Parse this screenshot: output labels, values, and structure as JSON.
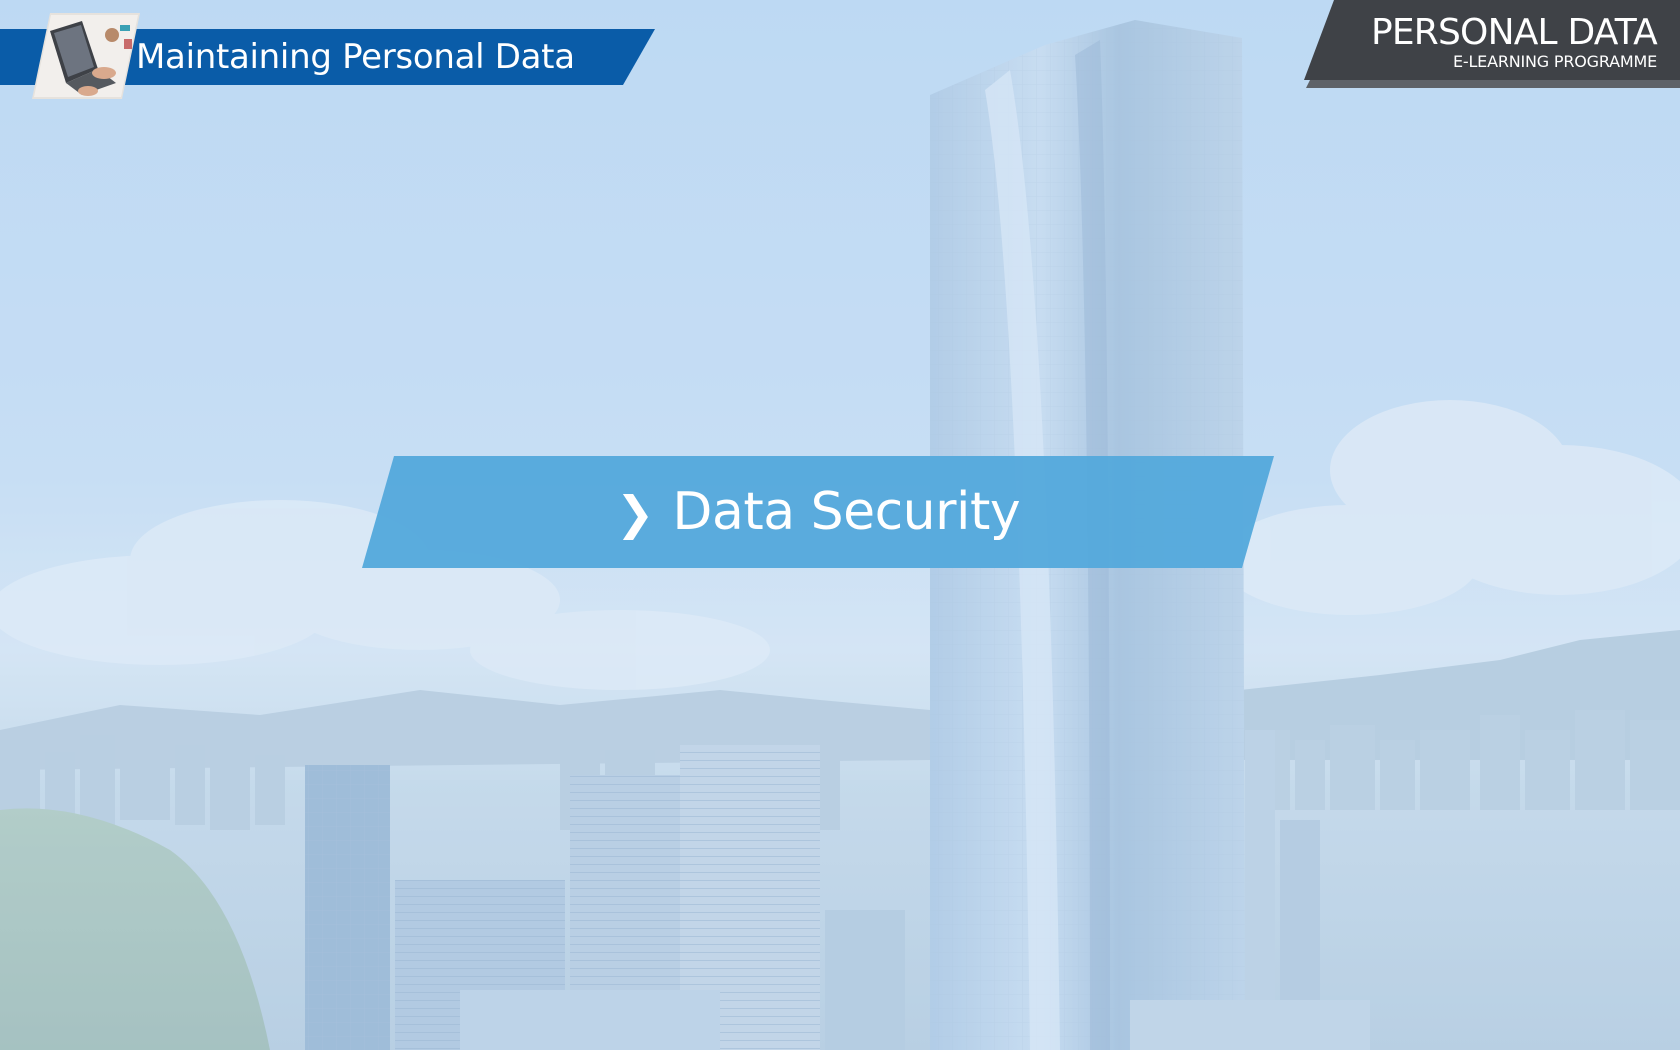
{
  "header": {
    "title": "Maintaining Personal Data",
    "thumbnail_icon": "laptop-workspace-photo"
  },
  "brand": {
    "title": "PERSONAL DATA",
    "subtitle": "E-LEARNING PROGRAMME"
  },
  "section": {
    "chevron": "❯",
    "title": "Data Security"
  },
  "background": {
    "image": "city-skyline-with-skyscraper-and-harbour"
  },
  "colors": {
    "header_banner": "#0a5ca8",
    "brand_banner": "#4a4d52",
    "section_banner": "#56a9dc",
    "sky": "#b9d7f3"
  }
}
